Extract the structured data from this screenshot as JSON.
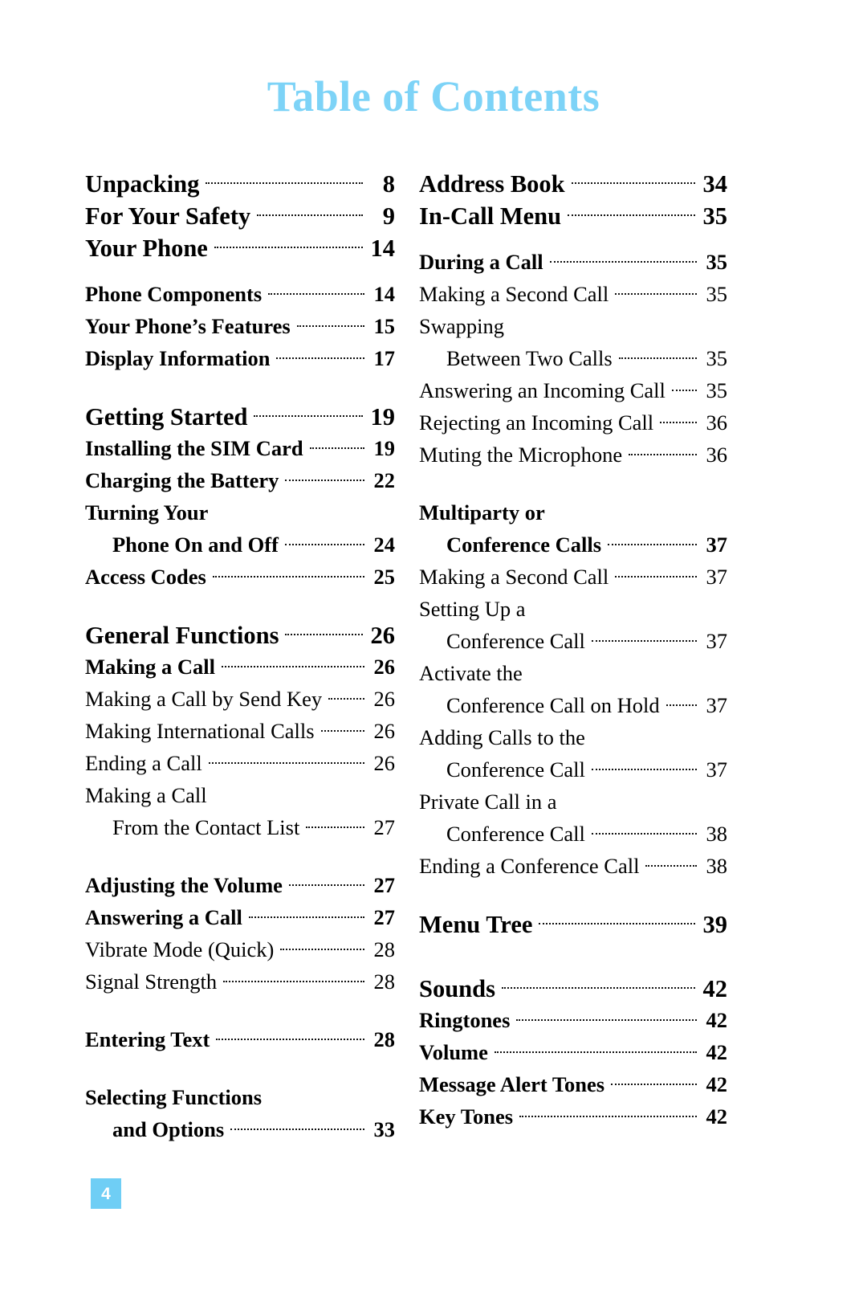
{
  "page": {
    "title": "Table of Contents",
    "title_color": "#7dd3f7",
    "page_number": "4",
    "page_badge_color": "#6fcef5"
  },
  "columns": {
    "left": [
      {
        "kind": "entry",
        "level": 1,
        "indent": false,
        "label": "Unpacking",
        "page": "8"
      },
      {
        "kind": "entry",
        "level": 1,
        "indent": false,
        "label": "For Your Safety",
        "page": "9"
      },
      {
        "kind": "entry",
        "level": 1,
        "indent": false,
        "label": "Your Phone",
        "page": "14"
      },
      {
        "kind": "gap",
        "size": "sm"
      },
      {
        "kind": "entry",
        "level": 2,
        "indent": false,
        "label": "Phone Components",
        "page": "14"
      },
      {
        "kind": "entry",
        "level": 2,
        "indent": false,
        "label": "Your Phone’s Features",
        "page": "15"
      },
      {
        "kind": "entry",
        "level": 2,
        "indent": false,
        "label": "Display Information",
        "page": "17"
      },
      {
        "kind": "gap",
        "size": "md"
      },
      {
        "kind": "entry",
        "level": 1,
        "indent": false,
        "label": "Getting Started",
        "page": "19"
      },
      {
        "kind": "entry",
        "level": 2,
        "indent": false,
        "label": "Installing the SIM Card",
        "page": "19"
      },
      {
        "kind": "entry",
        "level": 2,
        "indent": false,
        "label": "Charging the Battery",
        "page": "22"
      },
      {
        "kind": "entry",
        "level": 2,
        "indent": false,
        "label": "Turning Your",
        "page": "",
        "noleader": true
      },
      {
        "kind": "entry",
        "level": 2,
        "indent": true,
        "label": "Phone On and Off",
        "page": "24"
      },
      {
        "kind": "entry",
        "level": 2,
        "indent": false,
        "label": "Access Codes",
        "page": "25"
      },
      {
        "kind": "gap",
        "size": "md"
      },
      {
        "kind": "entry",
        "level": 1,
        "indent": false,
        "label": "General Functions",
        "page": "26"
      },
      {
        "kind": "entry",
        "level": 2,
        "indent": false,
        "label": "Making a Call",
        "page": "26"
      },
      {
        "kind": "entry",
        "level": 3,
        "indent": false,
        "label": "Making a Call by Send Key",
        "page": "26"
      },
      {
        "kind": "entry",
        "level": 3,
        "indent": false,
        "label": "Making International Calls",
        "page": "26"
      },
      {
        "kind": "entry",
        "level": 3,
        "indent": false,
        "label": "Ending a Call",
        "page": "26"
      },
      {
        "kind": "entry",
        "level": 3,
        "indent": false,
        "label": "Making a Call",
        "page": "",
        "noleader": true
      },
      {
        "kind": "entry",
        "level": 3,
        "indent": true,
        "label": "From the Contact List",
        "page": "27"
      },
      {
        "kind": "gap",
        "size": "md"
      },
      {
        "kind": "entry",
        "level": 2,
        "indent": false,
        "label": "Adjusting the Volume",
        "page": "27"
      },
      {
        "kind": "entry",
        "level": 2,
        "indent": false,
        "label": "Answering a Call",
        "page": "27"
      },
      {
        "kind": "entry",
        "level": 3,
        "indent": false,
        "label": "Vibrate Mode (Quick)",
        "page": "28"
      },
      {
        "kind": "entry",
        "level": 3,
        "indent": false,
        "label": "Signal Strength",
        "page": "28"
      },
      {
        "kind": "gap",
        "size": "md"
      },
      {
        "kind": "entry",
        "level": 2,
        "indent": false,
        "label": "Entering Text",
        "page": "28"
      },
      {
        "kind": "gap",
        "size": "md"
      },
      {
        "kind": "entry",
        "level": 2,
        "indent": false,
        "label": "Selecting Functions",
        "page": "",
        "noleader": true
      },
      {
        "kind": "entry",
        "level": 2,
        "indent": true,
        "label": "and Options",
        "page": "33"
      }
    ],
    "right": [
      {
        "kind": "entry",
        "level": 1,
        "indent": false,
        "label": "Address Book",
        "page": "34"
      },
      {
        "kind": "entry",
        "level": 1,
        "indent": false,
        "label": "In-Call Menu",
        "page": "35"
      },
      {
        "kind": "gap",
        "size": "sm"
      },
      {
        "kind": "entry",
        "level": 2,
        "indent": false,
        "label": "During a Call",
        "page": "35"
      },
      {
        "kind": "entry",
        "level": 3,
        "indent": false,
        "label": "Making a Second Call",
        "page": "35"
      },
      {
        "kind": "entry",
        "level": 3,
        "indent": false,
        "label": "Swapping",
        "page": "",
        "noleader": true
      },
      {
        "kind": "entry",
        "level": 3,
        "indent": true,
        "label": "Between Two Calls",
        "page": "35"
      },
      {
        "kind": "entry",
        "level": 3,
        "indent": false,
        "label": "Answering an Incoming Call",
        "page": "35"
      },
      {
        "kind": "entry",
        "level": 3,
        "indent": false,
        "label": "Rejecting an Incoming Call",
        "page": "36"
      },
      {
        "kind": "entry",
        "level": 3,
        "indent": false,
        "label": "Muting the Microphone",
        "page": "36"
      },
      {
        "kind": "gap",
        "size": "md"
      },
      {
        "kind": "entry",
        "level": 2,
        "indent": false,
        "label": "Multiparty or",
        "page": "",
        "noleader": true
      },
      {
        "kind": "entry",
        "level": 2,
        "indent": true,
        "label": "Conference Calls",
        "page": "37"
      },
      {
        "kind": "entry",
        "level": 3,
        "indent": false,
        "label": "Making a Second Call",
        "page": "37"
      },
      {
        "kind": "entry",
        "level": 3,
        "indent": false,
        "label": "Setting Up a",
        "page": "",
        "noleader": true
      },
      {
        "kind": "entry",
        "level": 3,
        "indent": true,
        "label": "Conference Call",
        "page": "37"
      },
      {
        "kind": "entry",
        "level": 3,
        "indent": false,
        "label": "Activate the",
        "page": "",
        "noleader": true
      },
      {
        "kind": "entry",
        "level": 3,
        "indent": true,
        "label": "Conference Call on Hold",
        "page": "37"
      },
      {
        "kind": "entry",
        "level": 3,
        "indent": false,
        "label": "Adding Calls to the",
        "page": "",
        "noleader": true
      },
      {
        "kind": "entry",
        "level": 3,
        "indent": true,
        "label": "Conference Call",
        "page": "37"
      },
      {
        "kind": "entry",
        "level": 3,
        "indent": false,
        "label": "Private Call in a",
        "page": "",
        "noleader": true
      },
      {
        "kind": "entry",
        "level": 3,
        "indent": true,
        "label": "Conference Call",
        "page": "38"
      },
      {
        "kind": "entry",
        "level": 3,
        "indent": false,
        "label": "Ending a Conference Call",
        "page": "38"
      },
      {
        "kind": "gap",
        "size": "md"
      },
      {
        "kind": "entry",
        "level": 1,
        "indent": false,
        "label": "Menu Tree",
        "page": "39"
      },
      {
        "kind": "gap",
        "size": "lg"
      },
      {
        "kind": "entry",
        "level": 1,
        "indent": false,
        "label": "Sounds",
        "page": "42"
      },
      {
        "kind": "entry",
        "level": 2,
        "indent": false,
        "label": "Ringtones",
        "page": "42"
      },
      {
        "kind": "entry",
        "level": 2,
        "indent": false,
        "label": "Volume",
        "page": "42"
      },
      {
        "kind": "entry",
        "level": 2,
        "indent": false,
        "label": "Message Alert Tones",
        "page": "42"
      },
      {
        "kind": "entry",
        "level": 2,
        "indent": false,
        "label": "Key Tones",
        "page": "42"
      }
    ]
  }
}
